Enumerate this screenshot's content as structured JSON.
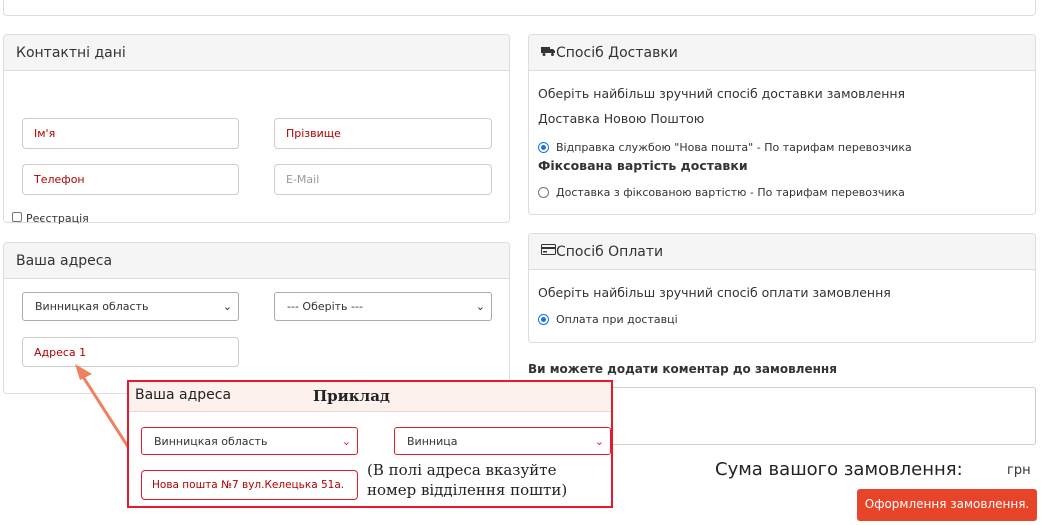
{
  "contacts": {
    "title": "Контактні дані",
    "first_name_placeholder": "Ім'я",
    "last_name_placeholder": "Прізвище",
    "phone_placeholder": "Телефон",
    "email_placeholder": "E-Mail",
    "register_label": "Реєстрація"
  },
  "address": {
    "title": "Ваша адреса",
    "region_value": "Винницкая область",
    "city_value": "--- Оберіть ---",
    "address_placeholder": "Адреса 1"
  },
  "delivery": {
    "title": "Спосіб Доставки",
    "hint": "Оберіть найбільш зручний спосіб доставки замовлення",
    "group1_title": "Доставка Новою Поштою",
    "option1_label": "Відправка службою \"Нова пошта\" - По тарифам перевозчика",
    "group2_title": "Фіксована вартість доставки",
    "option2_label": "Доставка з фіксованою вартістю - По тарифам перевозчика",
    "selected_option": 1
  },
  "payment": {
    "title": "Спосіб Оплати",
    "hint": "Оберіть найбільш зручний спосіб оплати замовлення",
    "option1_label": "Оплата при доставці"
  },
  "comment": {
    "label": "Ви можете додати коментар до замовлення",
    "value": ""
  },
  "order": {
    "total_label": "Сума вашого замовлення:",
    "total_value": "",
    "currency": "грн",
    "submit_label": "Оформлення замовлення."
  },
  "example": {
    "title": "Ваша адреса",
    "heading": "Приклад",
    "region_value": "Винницкая область",
    "city_value": "Винница",
    "address_value": "Нова пошта №7 вул.Келецька 51а.",
    "note": "(В полі адреса вказуйте номер відділення пошти)",
    "accent_color": "#e8192c",
    "arrow_color": "#f08060"
  }
}
